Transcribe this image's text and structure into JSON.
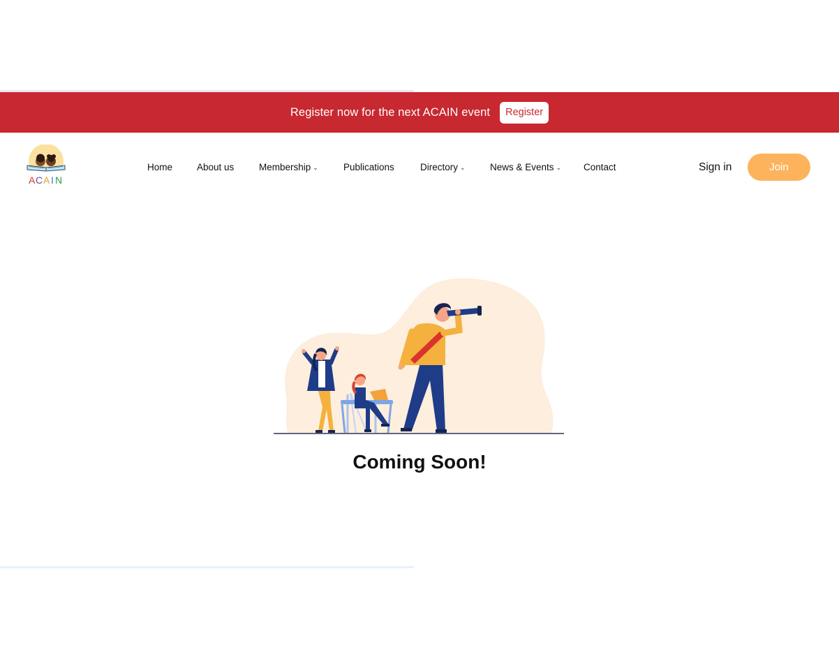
{
  "banner": {
    "text": "Register now for the next ACAIN event",
    "button_label": "Register"
  },
  "logo": {
    "letters": [
      "A",
      "C",
      "A",
      "I",
      "N"
    ],
    "letter_colors": [
      "#d9342b",
      "#7b3fa3",
      "#e7a521",
      "#3a7bd5",
      "#2e9e4f"
    ]
  },
  "nav": {
    "items": [
      {
        "label": "Home",
        "has_dropdown": false
      },
      {
        "label": "About us",
        "has_dropdown": false
      },
      {
        "label": "Membership",
        "has_dropdown": true
      },
      {
        "label": "Publications",
        "has_dropdown": false
      },
      {
        "label": "Directory",
        "has_dropdown": true
      },
      {
        "label": "News & Events",
        "has_dropdown": true
      },
      {
        "label": "Contact",
        "has_dropdown": false
      }
    ],
    "chevron": "⌄"
  },
  "auth": {
    "signin_label": "Sign in",
    "join_label": "Join"
  },
  "main": {
    "heading": "Coming Soon!",
    "illustration_icon": "telescope-team-illustration"
  },
  "colors": {
    "banner_red": "#c8282f",
    "join_orange": "#fdb35c",
    "blob_peach": "#fdeedd"
  }
}
